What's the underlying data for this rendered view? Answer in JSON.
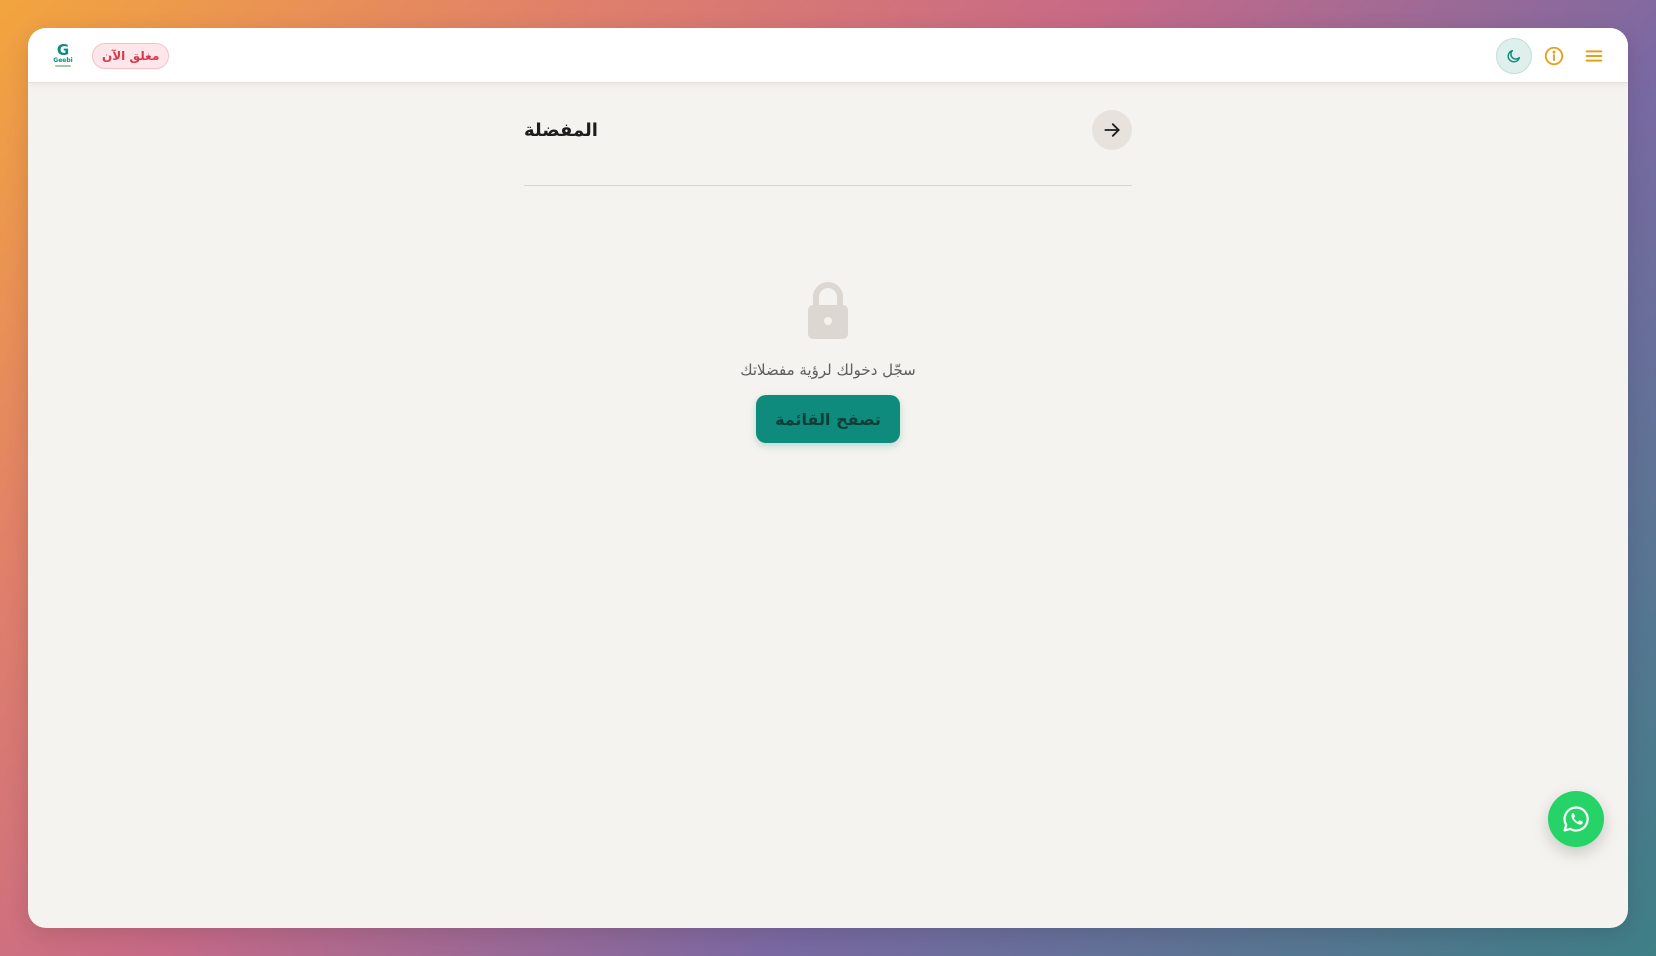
{
  "header": {
    "logo_text": "Geebi",
    "logo_mark": "G",
    "status_badge": "مغلق الآن",
    "icons": [
      "moon-icon",
      "info-icon",
      "menu-icon"
    ]
  },
  "page": {
    "title": "المفضلة",
    "back_icon": "arrow-right-icon"
  },
  "empty_state": {
    "icon": "lock-icon",
    "message": "سجّل دخولك لرؤية مفضلاتك",
    "button_label": "تصفح القائمة"
  },
  "fab": {
    "icon": "whatsapp-icon"
  },
  "colors": {
    "brand": "#0f8b7d",
    "badge_text": "#d9374a",
    "badge_bg": "#fde7ea",
    "accent_icons": "#e3a21a",
    "whatsapp": "#25d366",
    "surface": "#f5f3ef"
  }
}
